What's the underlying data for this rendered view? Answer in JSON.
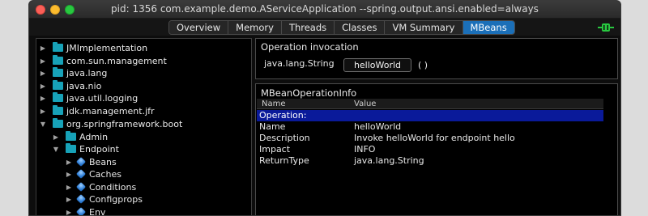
{
  "window": {
    "title": "pid: 1356 com.example.demo.AServiceApplication --spring.output.ansi.enabled=always"
  },
  "tabs": [
    {
      "label": "Overview"
    },
    {
      "label": "Memory"
    },
    {
      "label": "Threads"
    },
    {
      "label": "Classes"
    },
    {
      "label": "VM Summary"
    },
    {
      "label": "MBeans",
      "active": true
    }
  ],
  "tree": {
    "items": [
      {
        "label": "JMImplementation",
        "type": "folder",
        "expanded": false
      },
      {
        "label": "com.sun.management",
        "type": "folder",
        "expanded": false
      },
      {
        "label": "java.lang",
        "type": "folder",
        "expanded": false
      },
      {
        "label": "java.nio",
        "type": "folder",
        "expanded": false
      },
      {
        "label": "java.util.logging",
        "type": "folder",
        "expanded": false
      },
      {
        "label": "jdk.management.jfr",
        "type": "folder",
        "expanded": false
      },
      {
        "label": "org.springframework.boot",
        "type": "folder",
        "expanded": true
      },
      {
        "label": "Admin",
        "type": "folder",
        "expanded": false
      },
      {
        "label": "Endpoint",
        "type": "folder",
        "expanded": true
      },
      {
        "label": "Beans",
        "type": "bean",
        "expanded": false
      },
      {
        "label": "Caches",
        "type": "bean",
        "expanded": false
      },
      {
        "label": "Conditions",
        "type": "bean",
        "expanded": false
      },
      {
        "label": "Configprops",
        "type": "bean",
        "expanded": false
      },
      {
        "label": "Env",
        "type": "bean",
        "expanded": false
      }
    ]
  },
  "invocation": {
    "section_title": "Operation invocation",
    "return_type": "java.lang.String",
    "button_label": "helloWorld",
    "params": "( )"
  },
  "info": {
    "section_title": "MBeanOperationInfo",
    "columns": [
      "Name",
      "Value"
    ],
    "rows": [
      {
        "name": "Operation:",
        "value": "",
        "highlight": true
      },
      {
        "name": "Name",
        "value": "helloWorld"
      },
      {
        "name": "Description",
        "value": "Invoke helloWorld for endpoint hello"
      },
      {
        "name": "Impact",
        "value": "INFO"
      },
      {
        "name": "ReturnType",
        "value": "java.lang.String"
      }
    ]
  },
  "colors": {
    "active_tab": "#1b6fb8",
    "folder": "#17a2b8",
    "highlight_row": "#0a1a9a",
    "background": "#000000"
  }
}
